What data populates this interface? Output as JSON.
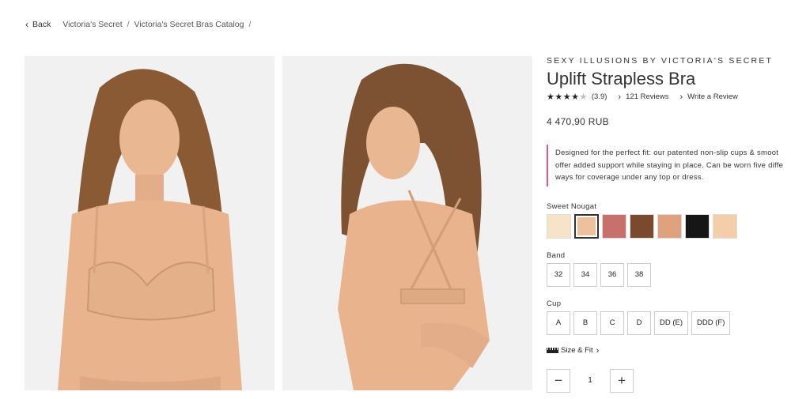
{
  "breadcrumb": {
    "back_label": "Back",
    "items": [
      "Victoria's Secret",
      "Victoria's Secret Bras Catalog"
    ],
    "separator": "/"
  },
  "images": [
    {
      "name": "model-front-photo"
    },
    {
      "name": "model-back-photo"
    }
  ],
  "product": {
    "brand": "SEXY ILLUSIONS BY VICTORIA'S SECRET",
    "title": "Uplift Strapless Bra",
    "rating": {
      "stars": 4,
      "max": 5,
      "value_text": "(3.9)"
    },
    "reviews_label": "121 Reviews",
    "write_review_label": "Write a Review",
    "price": "4 470,90 RUB",
    "description_lines": [
      "Designed for the perfect fit: our patented non-slip cups & smoot",
      "offer added support while staying in place. Can be worn five diffe",
      "ways for coverage under any top or dress."
    ],
    "color_label": "Sweet Nougat",
    "colors": [
      "#f7e3c8",
      "#eec09c",
      "#c8706b",
      "#7b4a2e",
      "#e0a27e",
      "#161616",
      "#f4cda9"
    ],
    "selected_color_index": 1,
    "band_label": "Band",
    "bands": [
      "32",
      "34",
      "36",
      "38"
    ],
    "cup_label": "Cup",
    "cups": [
      "A",
      "B",
      "C",
      "D",
      "DD (E)",
      "DDD (F)"
    ],
    "size_fit_label": "Size & Fit",
    "quantity": "1"
  },
  "icons": {
    "back": "chevron-left-icon",
    "link": "chevron-right-icon",
    "star": "star-icon",
    "ruler": "ruler-icon",
    "minus": "minus-icon",
    "plus": "plus-icon"
  },
  "colors": {
    "accent_bar": "#e6538a",
    "text": "#333333"
  }
}
